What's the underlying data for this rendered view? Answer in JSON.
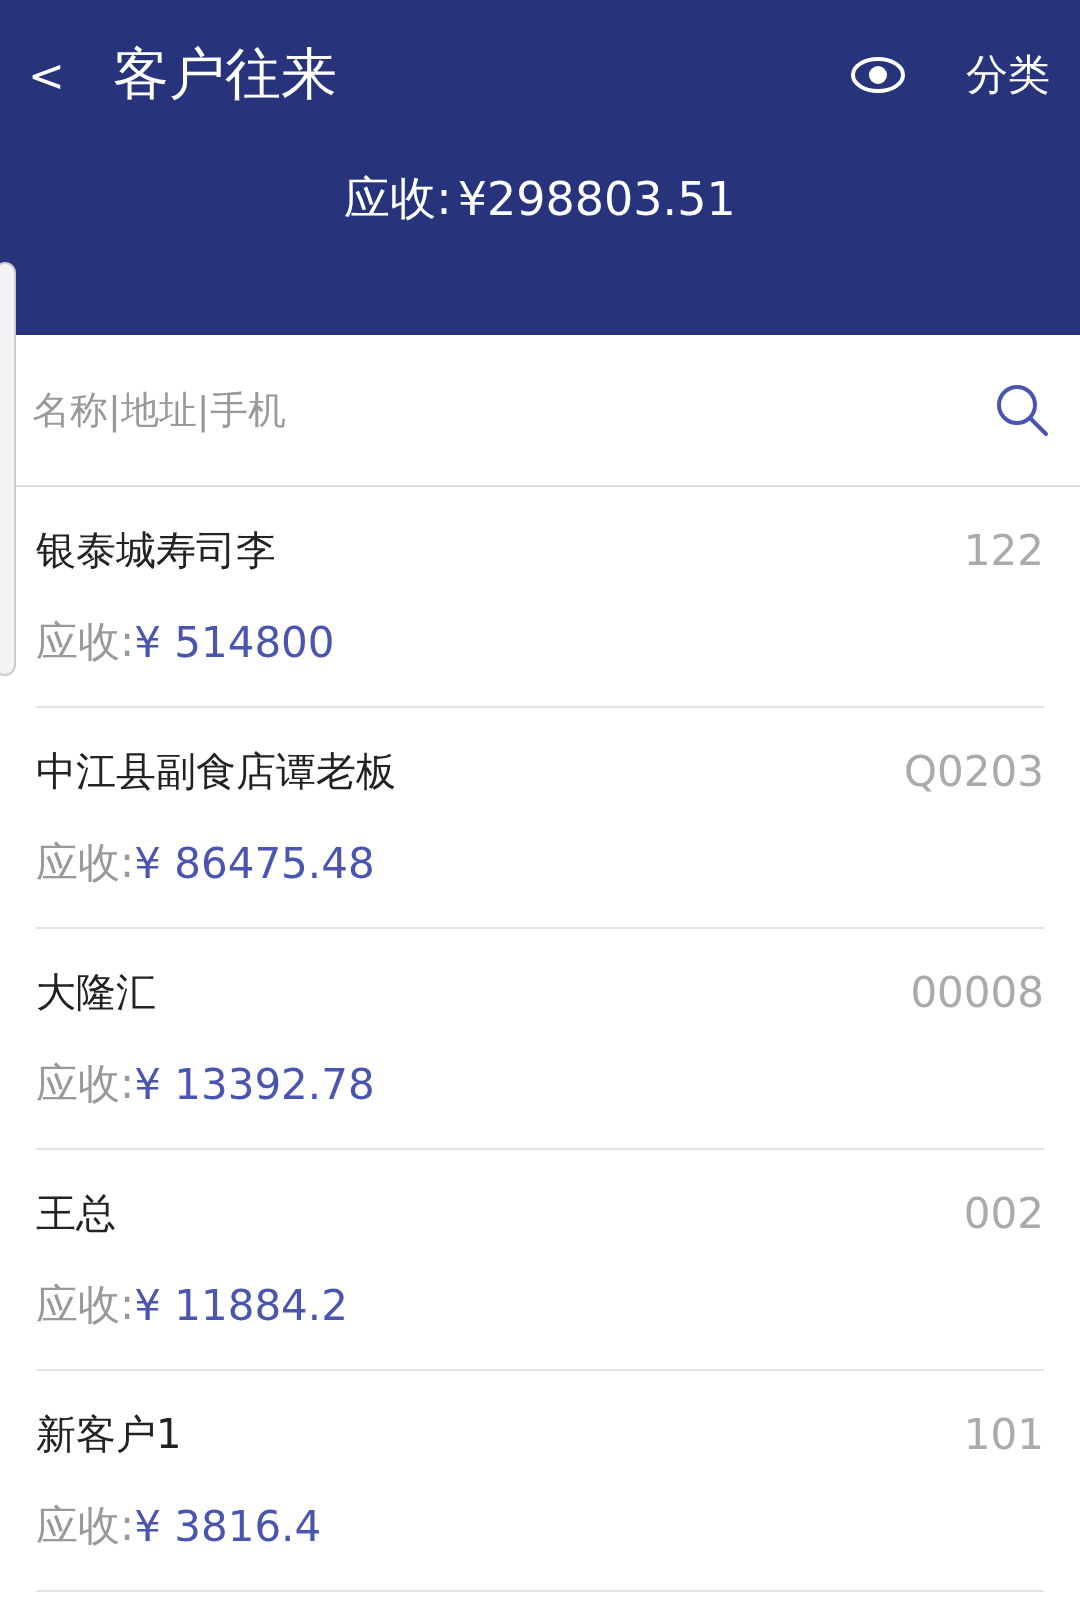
{
  "header": {
    "back": "<",
    "title": "客户往来",
    "category": "分类",
    "total_label": "应收:",
    "total_value": "¥298803.51"
  },
  "search": {
    "placeholder": "名称|地址|手机"
  },
  "customers": [
    {
      "name": "银泰城寿司李",
      "code": "122",
      "amount_label": "应收:",
      "amount": "¥ 514800"
    },
    {
      "name": "中江县副食店谭老板",
      "code": "Q0203",
      "amount_label": "应收:",
      "amount": "¥ 86475.48"
    },
    {
      "name": "大隆汇",
      "code": "00008",
      "amount_label": "应收:",
      "amount": "¥ 13392.78"
    },
    {
      "name": "王总",
      "code": "002",
      "amount_label": "应收:",
      "amount": "¥ 11884.2"
    },
    {
      "name": "新客户1",
      "code": "101",
      "amount_label": "应收:",
      "amount": "¥ 3816.4"
    }
  ]
}
